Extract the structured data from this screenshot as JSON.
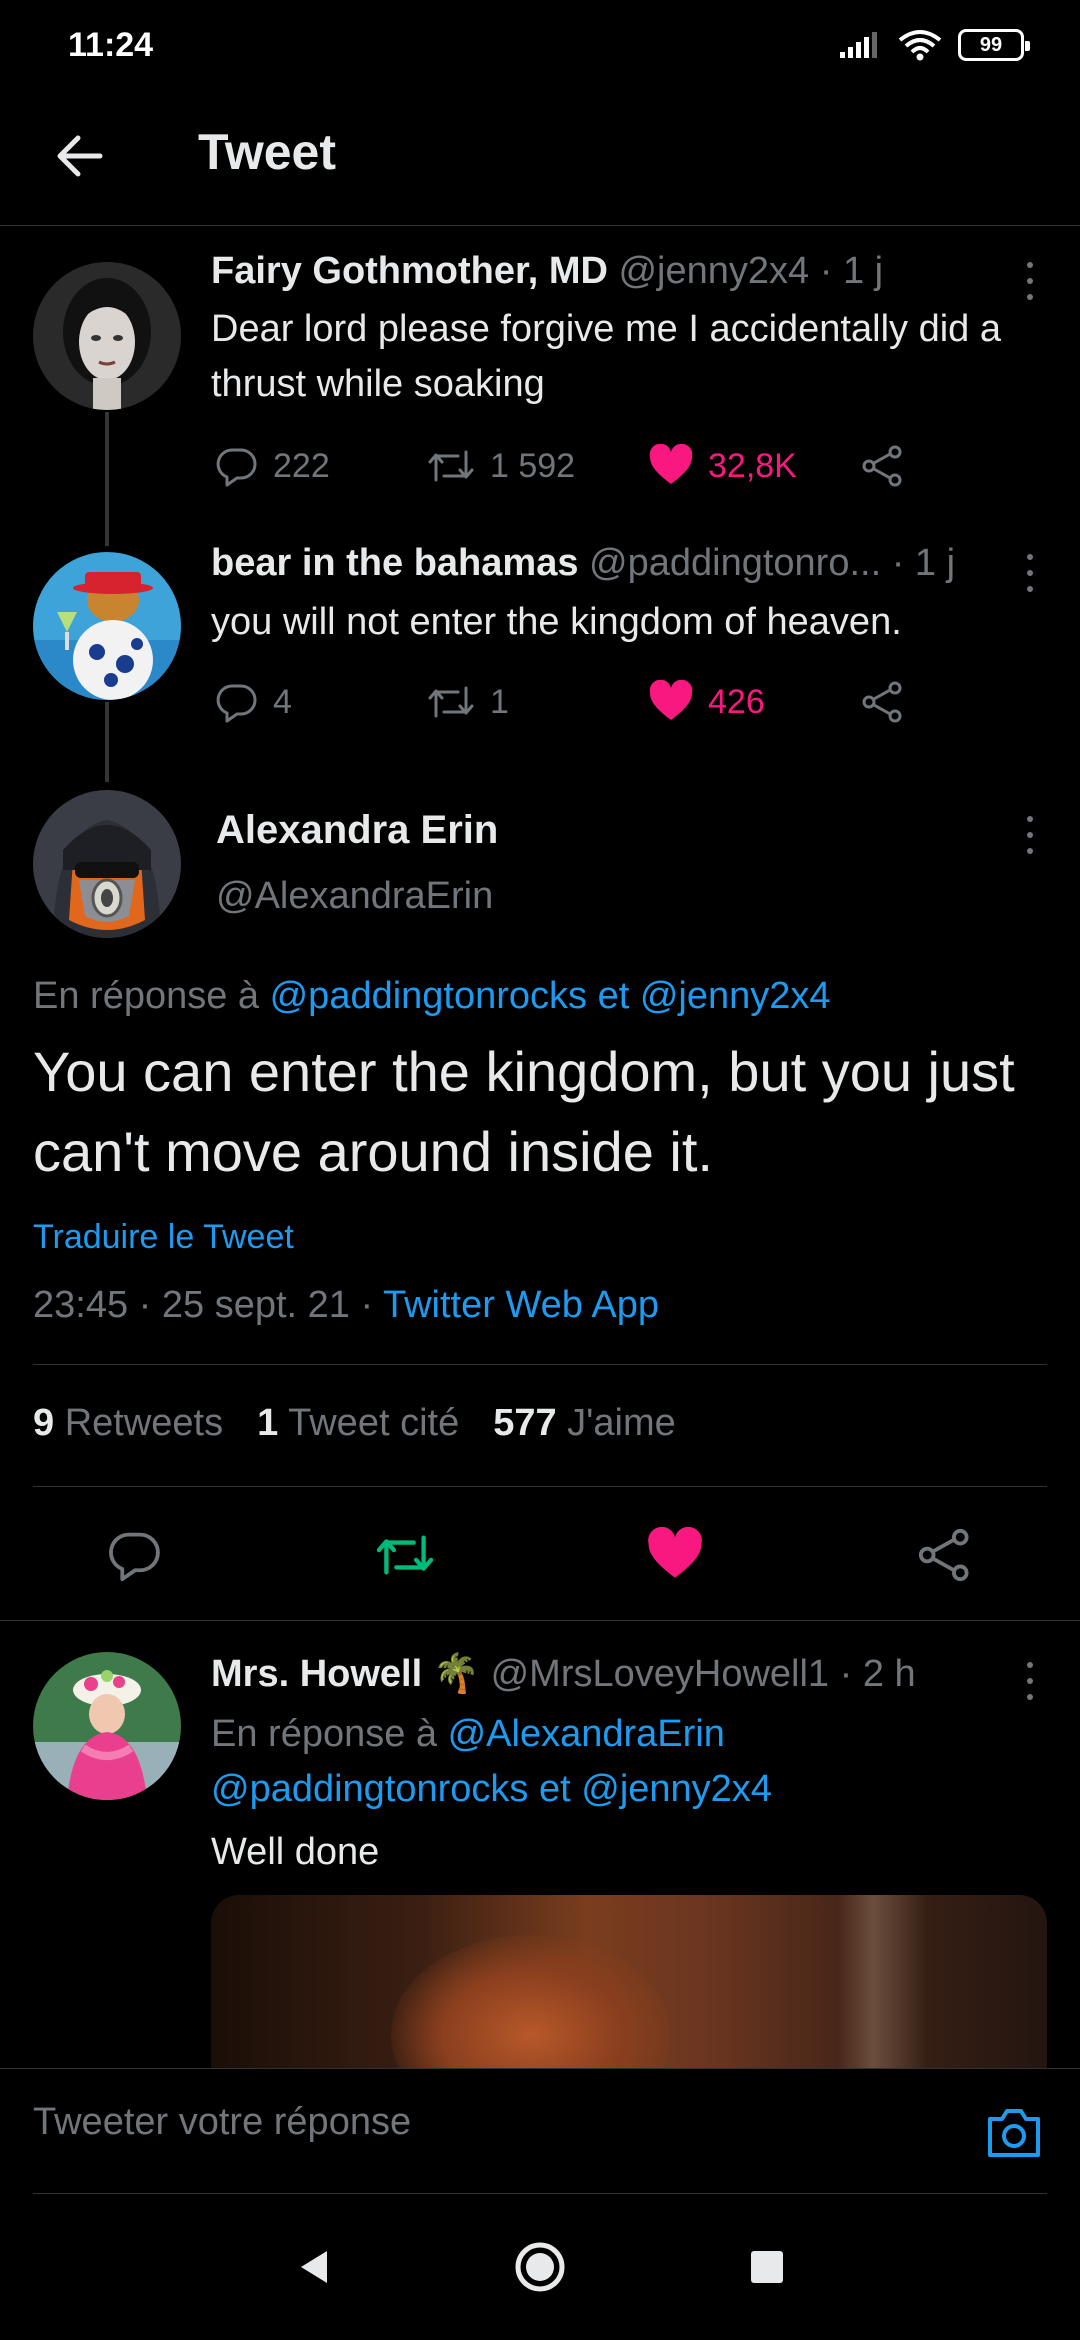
{
  "status_bar": {
    "time": "11:24",
    "battery": "99"
  },
  "header": {
    "title": "Tweet"
  },
  "thread": [
    {
      "name": "Fairy Gothmother, MD",
      "meta": "@jenny2x4 · 1 j",
      "text": "Dear lord please forgive me I accidentally did a thrust while soaking",
      "replies": "222",
      "retweets": "1 592",
      "likes": "32,8K"
    },
    {
      "name": "bear in the bahamas",
      "meta": "@paddingtonro... · 1 j",
      "text": "you will not enter the kingdom of heaven.",
      "replies": "4",
      "retweets": "1",
      "likes": "426"
    }
  ],
  "main_tweet": {
    "name": "Alexandra Erin",
    "handle": "@AlexandraErin",
    "reply_prefix": "En réponse à ",
    "reply_mention_1": "@paddingtonrocks",
    "reply_and": " et ",
    "reply_mention_2": "@jenny2x4",
    "text": "You can enter the kingdom, but you just can't move around inside it.",
    "translate": "Traduire le Tweet",
    "time_date": "23:45 · 25 sept. 21 · ",
    "source": "Twitter Web App",
    "stats": {
      "retweets_count": "9",
      "retweets_label": "Retweets",
      "quotes_count": "1",
      "quotes_label": "Tweet cité",
      "likes_count": "577",
      "likes_label": "J'aime"
    }
  },
  "reply_tweet": {
    "name": "Mrs. Howell",
    "emoji": "🌴",
    "meta": "@MrsLoveyHowell1 · 2 h",
    "reply_prefix": "En réponse à ",
    "mention_1": "@AlexandraErin",
    "mention_2": "@paddingtonrocks",
    "and": " et ",
    "mention_3": "@jenny2x4",
    "text": "Well done"
  },
  "reply_bar": {
    "placeholder": "Tweeter votre réponse"
  },
  "colors": {
    "accent": "#1d9bf0",
    "like": "#f91880",
    "retweet": "#00ba7c",
    "muted": "#71767b"
  },
  "icons": [
    "back-arrow-icon",
    "reply-icon",
    "retweet-icon",
    "heart-icon",
    "share-icon",
    "more-icon",
    "camera-icon",
    "nav-back-icon",
    "nav-home-icon",
    "nav-recents-icon"
  ]
}
